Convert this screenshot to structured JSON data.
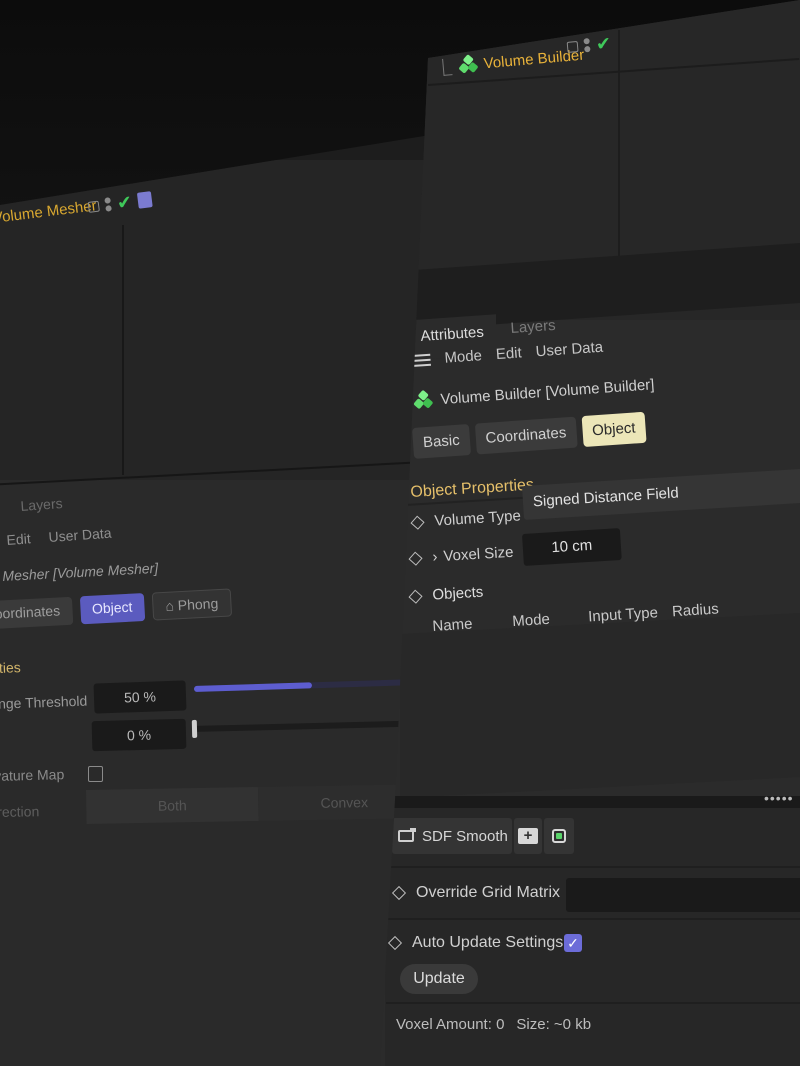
{
  "back_panel": {
    "title": "Volume Mesher",
    "layers_tab": "Layers",
    "menu": [
      "Edit",
      "User Data"
    ],
    "object_name": "Mesher [Volume Mesher]",
    "tabs": [
      "Coordinates",
      "Object",
      "Phong"
    ],
    "selected_tab": "Object",
    "section_title": "rties",
    "threshold_label": "ange Threshold",
    "threshold_value": "50 %",
    "threshold_fraction": 0.5,
    "second_value": "0 %",
    "curvature_label": "vature Map",
    "direction_label": "irection",
    "direction_options": [
      "Both",
      "Convex"
    ]
  },
  "front_panel": {
    "title": "Volume Builder",
    "tabs": [
      "Attributes",
      "Layers"
    ],
    "menu": [
      "Mode",
      "Edit",
      "User Data"
    ],
    "object_name": "Volume Builder [Volume Builder]",
    "object_tabs": [
      "Basic",
      "Coordinates",
      "Object"
    ],
    "selected_object_tab": "Object",
    "section_title": "Object Properties",
    "volume_type_label": "Volume Type",
    "volume_type_value": "Signed Distance Field",
    "voxel_size_label": "Voxel Size",
    "voxel_size_value": "10 cm",
    "objects_label": "Objects",
    "columns": [
      "Name",
      "Mode",
      "Input Type",
      "Radius"
    ],
    "resize_handle": "•••••",
    "filter_name": "SDF Smooth",
    "override_grid_label": "Override Grid Matrix",
    "auto_update_label": "Auto Update Settings",
    "auto_update_checked": true,
    "update_button": "Update",
    "voxel_amount": "Voxel Amount: 0",
    "size_text": "Size: ~0 kb"
  },
  "colors": {
    "title_accent": "#e8b23a",
    "selected_tab_front": "#ece6b8",
    "selected_tab_back": "#5b5bbf",
    "checkmark_green": "#3fc85a",
    "checkbox_accent": "#6c6cd8",
    "section_header": "#e6c06a"
  },
  "icons": [
    "cubes-icon",
    "check-icon",
    "hamburger-icon",
    "diamond-icon",
    "chevron-right-icon",
    "folder-plus-icon",
    "chip-icon",
    "wallet-icon"
  ]
}
